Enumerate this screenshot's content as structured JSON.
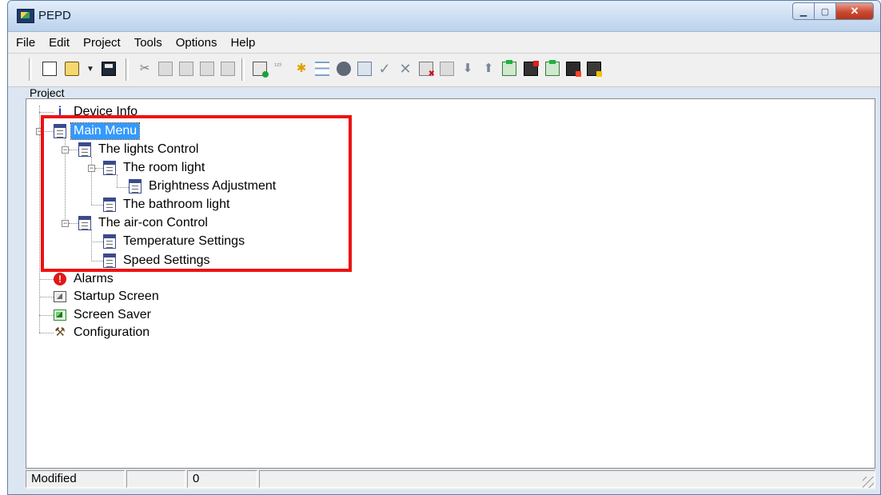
{
  "window": {
    "title": "PEPD"
  },
  "menu": [
    "File",
    "Edit",
    "Project",
    "Tools",
    "Options",
    "Help"
  ],
  "panel": {
    "label": "Project"
  },
  "tree": {
    "device_info": "Device Info",
    "main_menu": "Main Menu",
    "lights_control": "The lights Control",
    "room_light": "The room light",
    "brightness_adjustment": "Brightness Adjustment",
    "bathroom_light": "The bathroom light",
    "aircon_control": "The air-con Control",
    "temperature_settings": "Temperature Settings",
    "speed_settings": "Speed Settings",
    "alarms": "Alarms",
    "startup_screen": "Startup Screen",
    "screen_saver": "Screen Saver",
    "configuration": "Configuration",
    "selected": "Main Menu"
  },
  "status": {
    "state": "Modified",
    "empty": "",
    "count": "0"
  },
  "colors": {
    "highlight_box": "#ee1111",
    "selection": "#3399ff"
  }
}
